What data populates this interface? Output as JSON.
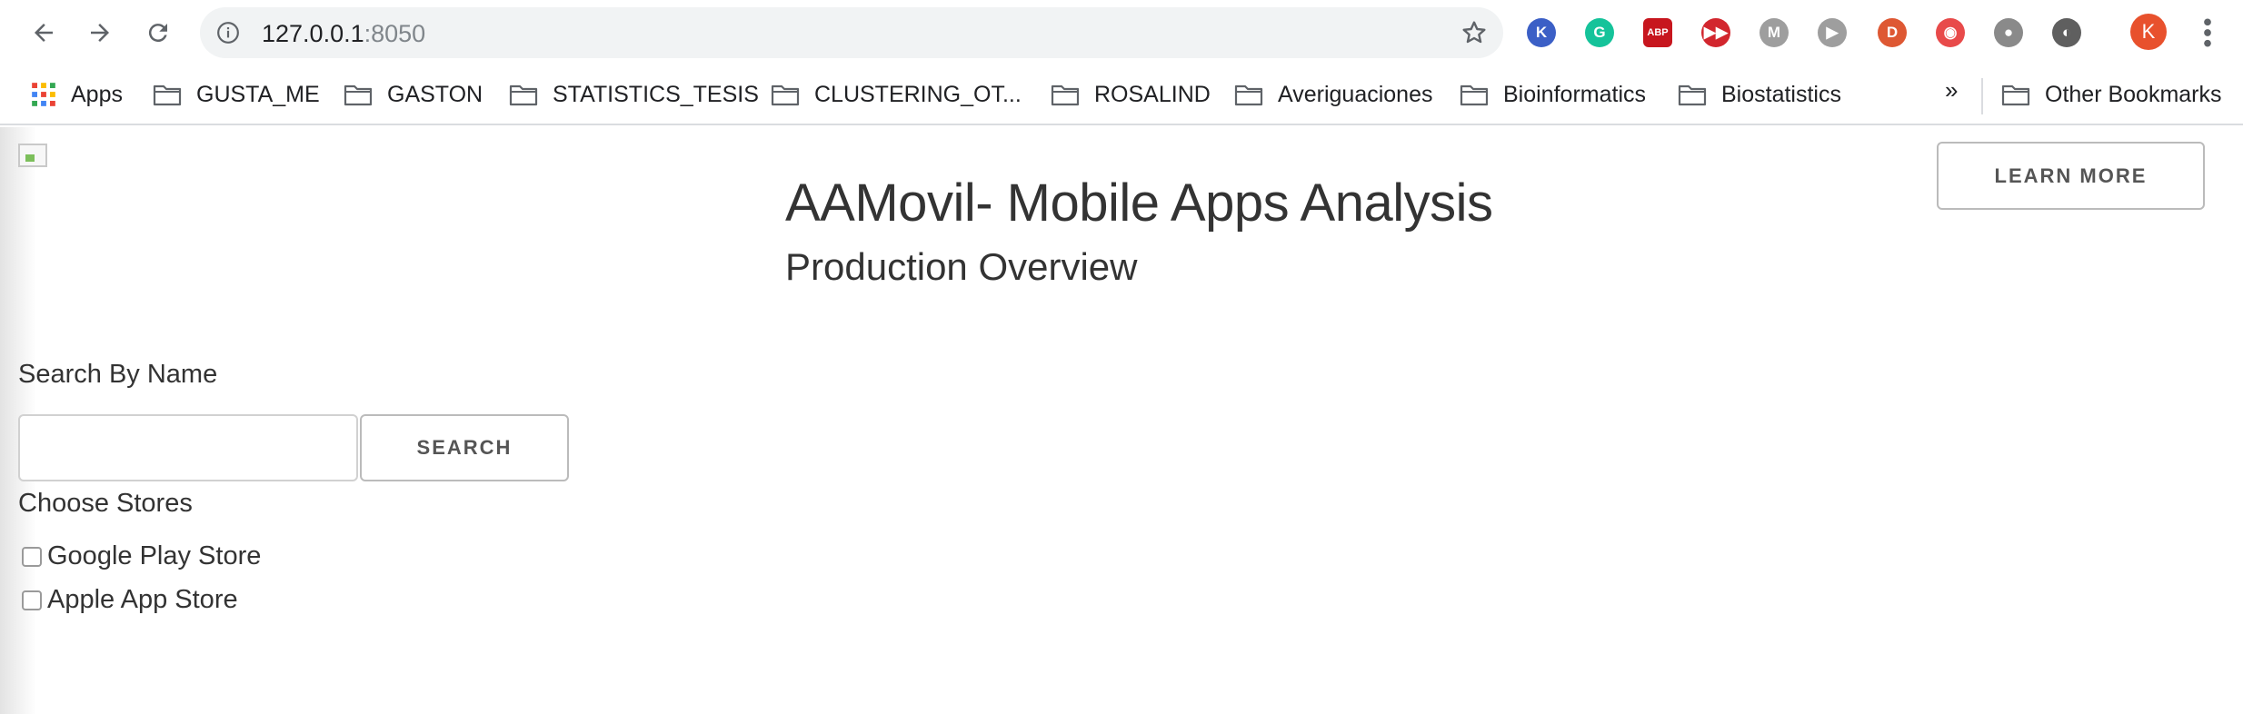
{
  "browser": {
    "url_host": "127.0.0.1",
    "url_port": ":8050",
    "profile_initial": "K",
    "extensions": [
      {
        "name": "k-extension-icon",
        "letter": "K",
        "color": "#3b5fc6"
      },
      {
        "name": "grammarly-icon",
        "letter": "G",
        "color": "#15c39a"
      },
      {
        "name": "adblock-plus-icon",
        "letter": "ABP",
        "color": "#c7161e"
      },
      {
        "name": "fast-forward-icon",
        "letter": "▶▶",
        "color": "#d2262e"
      },
      {
        "name": "mail-checker-icon",
        "letter": "M",
        "color": "#9e9e9e"
      },
      {
        "name": "play-icon",
        "letter": "▶",
        "color": "#9e9e9e"
      },
      {
        "name": "duckduckgo-icon",
        "letter": "D",
        "color": "#de5833"
      },
      {
        "name": "camera-extension-icon",
        "letter": "◉",
        "color": "#e84a4a"
      },
      {
        "name": "tomato-timer-icon",
        "letter": "●",
        "color": "#8a8a8a"
      },
      {
        "name": "dark-reader-icon",
        "letter": "◐",
        "color": "#5f5f5f"
      }
    ]
  },
  "bookmarks": {
    "apps_label": "Apps",
    "items": [
      "GUSTA_ME",
      "GASTON",
      "STATISTICS_TESIS",
      "CLUSTERING_OT...",
      "ROSALIND",
      "Averiguaciones",
      "Bioinformatics",
      "Biostatistics"
    ],
    "overflow": "»",
    "other_label": "Other Bookmarks"
  },
  "page": {
    "title": "AAMovil- Mobile Apps Analysis",
    "subtitle": "Production Overview",
    "learn_more_label": "LEARN MORE",
    "search_label": "Search By Name",
    "search_value": "",
    "search_button_label": "SEARCH",
    "stores_label": "Choose Stores",
    "stores": [
      {
        "label": "Google Play Store",
        "checked": false
      },
      {
        "label": "Apple App Store",
        "checked": false
      }
    ]
  }
}
